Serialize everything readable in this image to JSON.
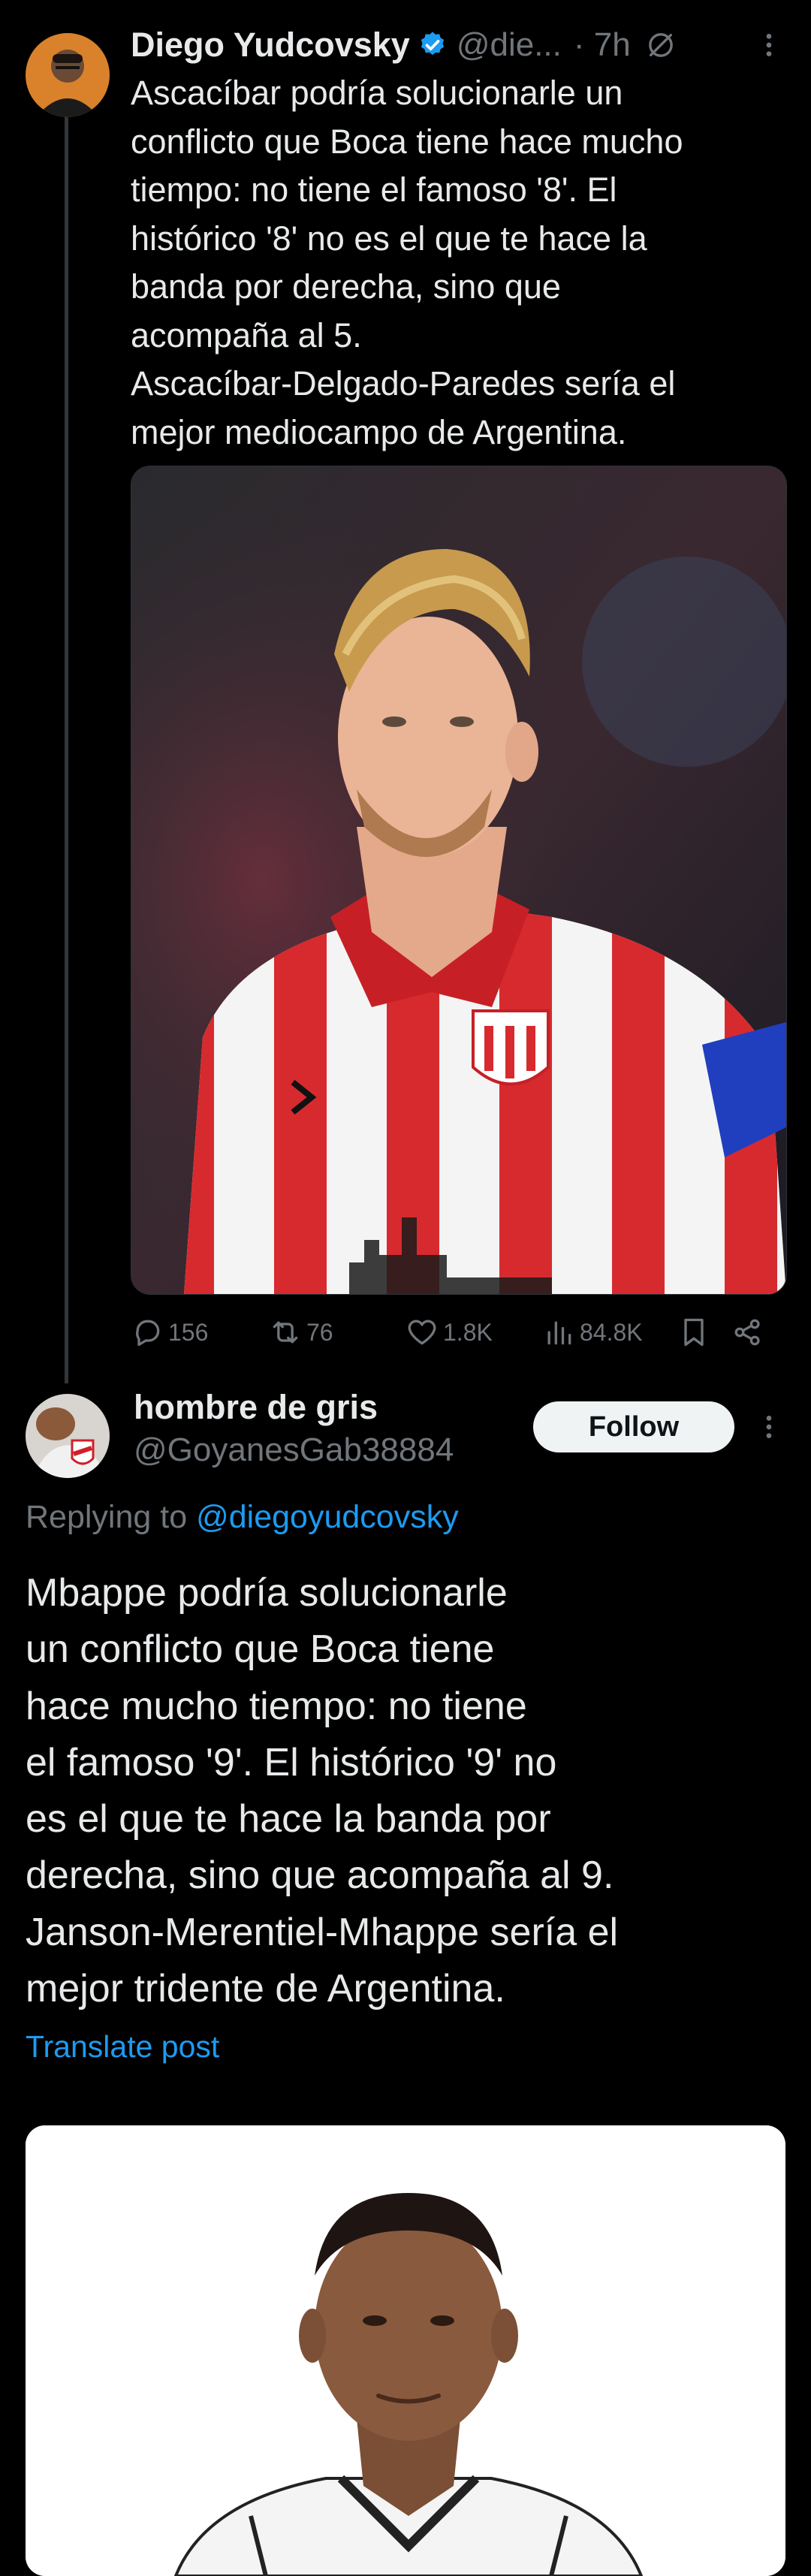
{
  "parent_tweet": {
    "author_name": "Diego Yudcovsky",
    "handle": "@die...",
    "time": "· 7h",
    "body_lines": [
      "Ascacíbar podría solucionarle un",
      "conflicto que Boca tiene hace mucho",
      "tiempo: no tiene el famoso '8'. El",
      "histórico '8' no es el que te hace la",
      "banda por derecha, sino que",
      "acompaña al 5.",
      "Ascacíbar-Delgado-Paredes sería el",
      "mejor mediocampo de Argentina."
    ],
    "media_icons": {
      "avatar": "avatar-icon",
      "verified": "verified-badge-icon",
      "grok": "grok-icon",
      "more": "more-icon"
    },
    "stats": {
      "replies": "156",
      "reposts": "76",
      "likes": "1.8K",
      "views": "84.8K"
    }
  },
  "reply_tweet": {
    "author_name": "hombre de gris",
    "handle": "@GoyanesGab38884",
    "follow_label": "Follow",
    "replying_prefix": "Replying to",
    "replying_to": "@diegoyudcovsky",
    "body_lines": [
      "Mbappe podría solucionarle",
      "un conflicto que Boca tiene",
      "hace mucho tiempo: no tiene",
      "el famoso '9'. El histórico '9' no",
      "es el que te hace la banda por",
      "derecha, sino que acompaña al 9.",
      "Janson-Merentiel-Mhappe sería el",
      "mejor tridente de Argentina."
    ],
    "translate_label": "Translate post"
  },
  "theme": {
    "background": "#000000",
    "text": "#e7e9ea",
    "muted": "#71767b",
    "accent": "#1d9bf0",
    "verified": "#1d9bf0"
  }
}
